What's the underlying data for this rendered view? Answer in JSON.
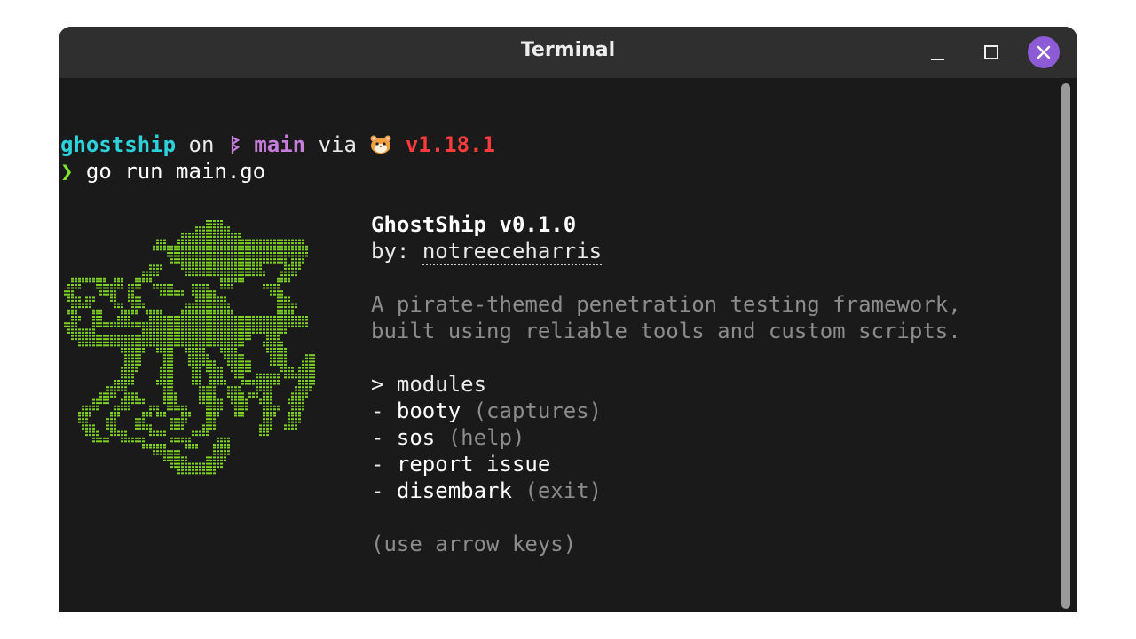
{
  "window": {
    "title": "Terminal",
    "close_color": "#8e5bd6"
  },
  "prompt": {
    "directory": "ghostship",
    "on_text": "on",
    "branch_icon": "git-branch-icon",
    "branch": "main",
    "via_text": "via",
    "lang_icon": "hamster-icon",
    "version": "v1.18.1",
    "prompt_char": "❯",
    "command": "go run main.go"
  },
  "app": {
    "title": "GhostShip v0.1.0",
    "by_label": "by:",
    "author": "notreeceharris",
    "description": [
      "A pirate-themed penetration testing framework,",
      "built using reliable tools and custom scripts."
    ],
    "menu_header": "> modules",
    "menu": [
      {
        "prefix": "-",
        "label": "booty",
        "hint": "(captures)"
      },
      {
        "prefix": "-",
        "label": "sos",
        "hint": "(help)"
      },
      {
        "prefix": "-",
        "label": "report issue",
        "hint": ""
      },
      {
        "prefix": "-",
        "label": "disembark",
        "hint": "(exit)"
      }
    ],
    "footer_hint": "(use arrow keys)"
  },
  "colors": {
    "directory": "#2cd2dc",
    "branch": "#c77ddc",
    "version": "#ff3b3b",
    "prompt_arrow": "#7fe62c",
    "ascii_art": "#7ed321",
    "muted_text": "#8c8c8c"
  }
}
